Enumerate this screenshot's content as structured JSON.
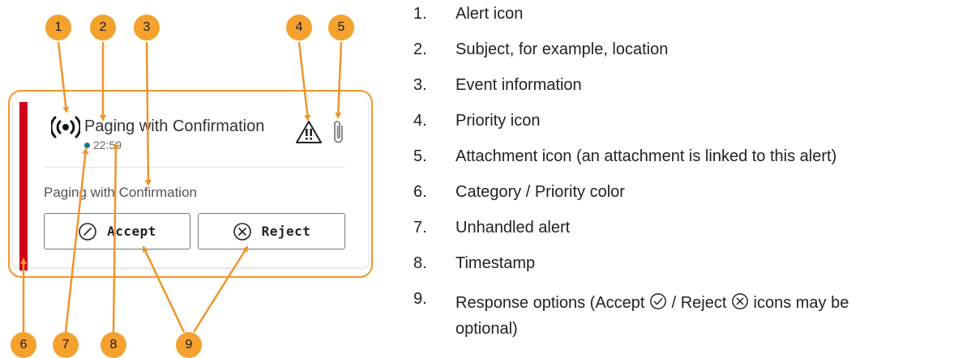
{
  "alert_card": {
    "subject": "Paging with Confirmation",
    "timestamp": "22:59",
    "event_info": "Paging with Confirmation",
    "accept_label": "Accept",
    "reject_label": "Reject",
    "priority_color": "#d0021b",
    "unhandled_color": "#167c88",
    "icons": {
      "alert": "broadcast-icon",
      "priority": "warning-triangle-icon",
      "attachment": "paperclip-icon",
      "accept": "circle-slash-icon",
      "reject": "circle-x-icon"
    }
  },
  "callouts": {
    "color": "#f4a12e",
    "markers": [
      "1",
      "2",
      "3",
      "4",
      "5",
      "6",
      "7",
      "8",
      "9"
    ]
  },
  "legend": {
    "items": [
      {
        "number": "1.",
        "text": "Alert icon"
      },
      {
        "number": "2.",
        "text": "Subject, for example, location"
      },
      {
        "number": "3.",
        "text": "Event information"
      },
      {
        "number": "4.",
        "text": "Priority icon"
      },
      {
        "number": "5.",
        "text": "Attachment icon (an attachment is linked to this alert)"
      },
      {
        "number": "6.",
        "text": "Category / Priority color"
      },
      {
        "number": "7.",
        "text": "Unhandled alert"
      },
      {
        "number": "8.",
        "text": "Timestamp"
      }
    ],
    "item9": {
      "number": "9.",
      "text_before": "Response options (Accept ",
      "text_middle": " / Reject ",
      "text_after": " icons may be",
      "text_line2": "optional)"
    }
  }
}
